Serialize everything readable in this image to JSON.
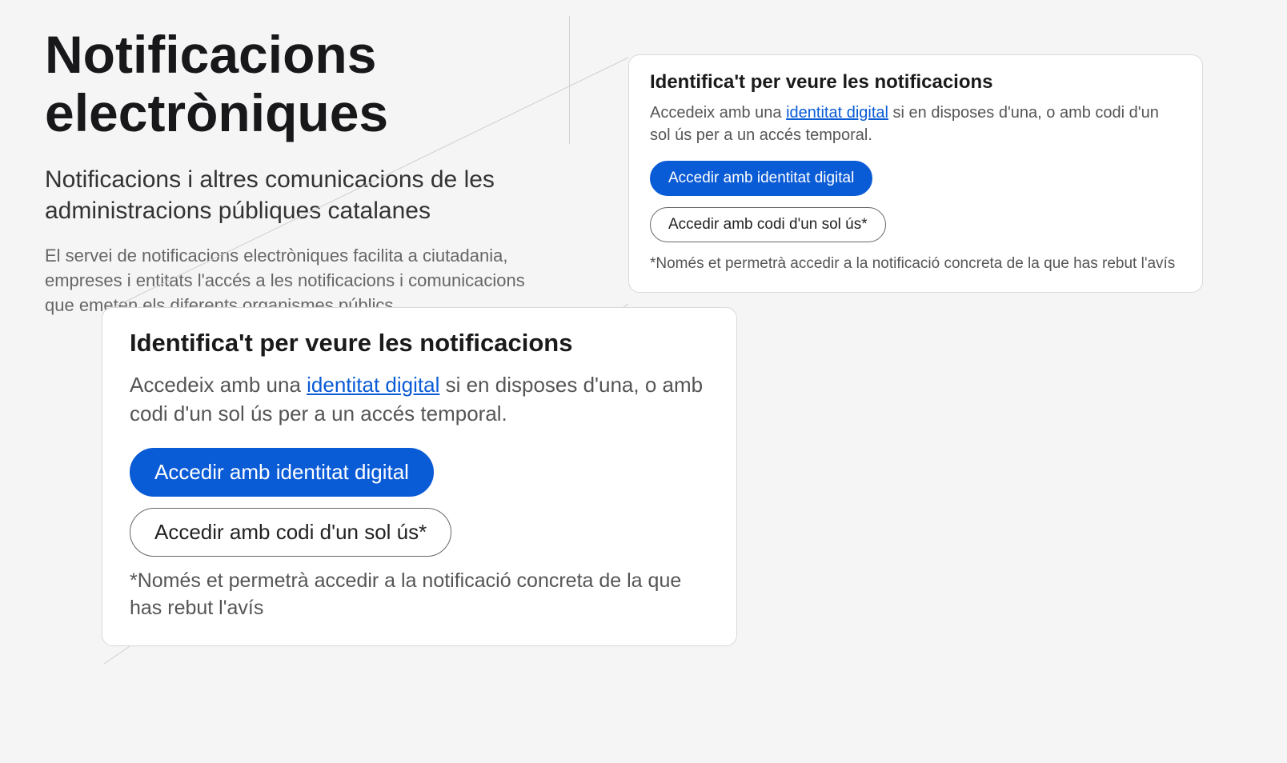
{
  "page": {
    "title": "Notificacions electròniques",
    "subtitle": "Notificacions i altres comunicacions de les administracions públiques catalanes",
    "description": "El servei de notificacions electròniques facilita a ciutadania, empreses i entitats l'accés a les notificacions i comunicacions que emeten els diferents organismes públics"
  },
  "card": {
    "title": "Identifica't per veure les notificacions",
    "desc_pre": "Accedeix amb una ",
    "desc_link": "identitat digital",
    "desc_post": " si en disposes d'una, o amb codi d'un sol ús per a un accés temporal.",
    "btn_primary": "Accedir amb identitat digital",
    "btn_secondary": "Accedir amb codi d'un sol ús*",
    "note": "*Només et permetrà accedir a la notificació concreta de la que has rebut l'avís"
  }
}
